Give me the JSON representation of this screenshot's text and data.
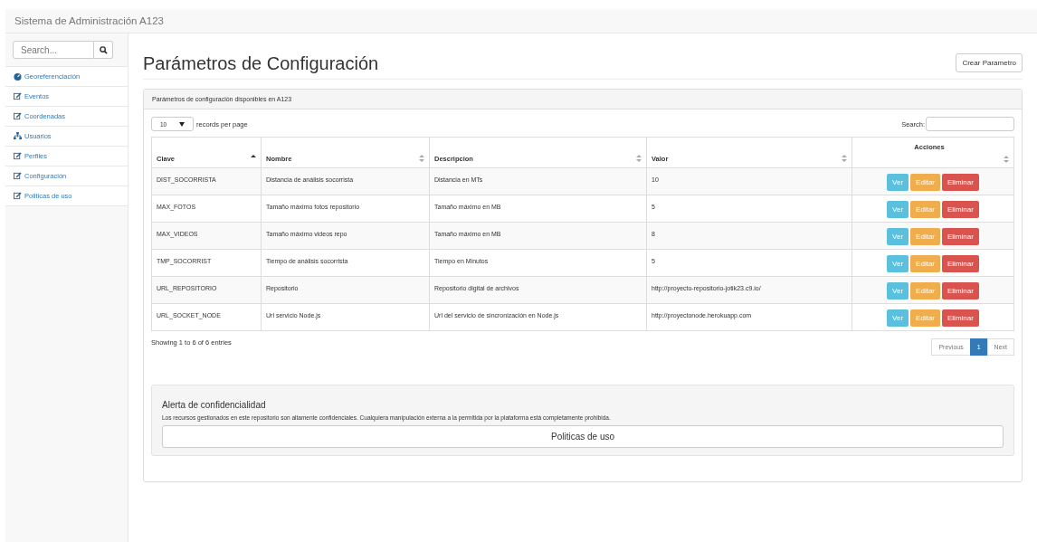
{
  "navbar": {
    "brand": "Sistema de Administración A123"
  },
  "sidebar": {
    "search": {
      "placeholder": "Search..."
    },
    "items": [
      {
        "label": "Georeferenciación",
        "kind": "dashboard"
      },
      {
        "label": "Eventos",
        "kind": "edit"
      },
      {
        "label": "Coordenadas",
        "kind": "edit"
      },
      {
        "label": "Usuarios",
        "kind": "sitemap"
      },
      {
        "label": "Perfiles",
        "kind": "edit"
      },
      {
        "label": "Configuración",
        "kind": "edit"
      },
      {
        "label": "Politicas de uso",
        "kind": "edit"
      }
    ]
  },
  "page": {
    "title": "Parámetros de Configuración",
    "create_button": "Crear Parametro"
  },
  "panel": {
    "heading": "Parámetros de configuración disponibles en A123",
    "length": {
      "value": "10",
      "label": "records per page"
    },
    "search": {
      "label": "Search:"
    },
    "table": {
      "columns": [
        {
          "label": "Clave",
          "kind": "asc"
        },
        {
          "label": "Nombre",
          "kind": "both"
        },
        {
          "label": "Descripcion",
          "kind": "both"
        },
        {
          "label": "Valor",
          "kind": "both"
        },
        {
          "label": "Acciones",
          "kind": "both"
        }
      ],
      "rows": [
        {
          "cells": [
            "DIST_SOCORRISTA",
            "Distancia de análisis socorrista",
            "Distancia en MTs",
            "10"
          ],
          "actions": [
            {
              "label": "Ver",
              "kind": "info"
            },
            {
              "label": "Editar",
              "kind": "warning"
            },
            {
              "label": "Eliminar",
              "kind": "danger"
            }
          ]
        },
        {
          "cells": [
            "MAX_FOTOS",
            "Tamaño máximo fotos repositorio",
            "Tamaño máximo en MB",
            "5"
          ],
          "actions": [
            {
              "label": "Ver",
              "kind": "info"
            },
            {
              "label": "Editar",
              "kind": "warning"
            },
            {
              "label": "Eliminar",
              "kind": "danger"
            }
          ]
        },
        {
          "cells": [
            "MAX_VIDEOS",
            "Tamaño máximo videos repo",
            "Tamaño máximo en MB",
            "8"
          ],
          "actions": [
            {
              "label": "Ver",
              "kind": "info"
            },
            {
              "label": "Editar",
              "kind": "warning"
            },
            {
              "label": "Eliminar",
              "kind": "danger"
            }
          ]
        },
        {
          "cells": [
            "TMP_SOCORRIST",
            "Tiempo de análisis socorrista",
            "Tiempo en Minutos",
            "5"
          ],
          "actions": [
            {
              "label": "Ver",
              "kind": "info"
            },
            {
              "label": "Editar",
              "kind": "warning"
            },
            {
              "label": "Eliminar",
              "kind": "danger"
            }
          ]
        },
        {
          "cells": [
            "URL_REPOSITORIO",
            "Repositorio",
            "Repositorio digital de archivos",
            "http://proyecto-repositorio-jotik23.c9.io/"
          ],
          "actions": [
            {
              "label": "Ver",
              "kind": "info"
            },
            {
              "label": "Editar",
              "kind": "warning"
            },
            {
              "label": "Eliminar",
              "kind": "danger"
            }
          ]
        },
        {
          "cells": [
            "URL_SOCKET_NODE",
            "Url servicio Node.js",
            "Url del servicio de sincronización en Node.js",
            "http://proyectonode.herokuapp.com"
          ],
          "actions": [
            {
              "label": "Ver",
              "kind": "info"
            },
            {
              "label": "Editar",
              "kind": "warning"
            },
            {
              "label": "Eliminar",
              "kind": "danger"
            }
          ]
        }
      ]
    },
    "info": "Showing 1 to 6 of 6 entries",
    "pagination": [
      {
        "label": "Previous",
        "selected": false
      },
      {
        "label": "1",
        "selected": true
      },
      {
        "label": "Next",
        "selected": false
      }
    ]
  },
  "alert": {
    "title": "Alerta de confidencialidad",
    "text": "Los recursos gestionados en este repositorio son altamente confidenciales. Cualquiera manipulación externa a la permitida por la plataforma está completamente prohibida.",
    "button": "Politicas de uso"
  }
}
